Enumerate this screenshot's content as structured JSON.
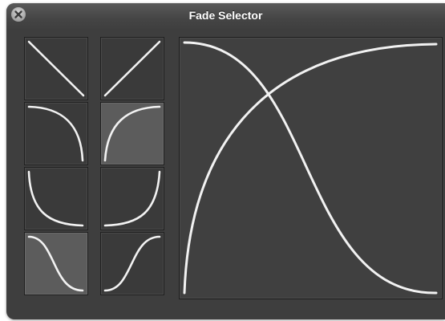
{
  "window": {
    "title": "Fade Selector",
    "close_icon": "close-x-icon"
  },
  "colors": {
    "window_bg": "#3e3e3e",
    "thumb_bg": "#3a3a3a",
    "thumb_selected_bg": "#5c5c5c",
    "curve": "#f2f2f2"
  },
  "fade_curves": {
    "left_column": [
      "linear-fade-out",
      "logarithmic-fade-out",
      "exponential-fade-out",
      "s-curve-fade-out"
    ],
    "right_column": [
      "linear-fade-in",
      "logarithmic-fade-in",
      "exponential-fade-in",
      "s-curve-fade-in"
    ],
    "selected": [
      "logarithmic-fade-in",
      "s-curve-fade-out"
    ]
  },
  "preview": {
    "curves": [
      "logarithmic-fade-in",
      "s-curve-fade-out"
    ]
  }
}
